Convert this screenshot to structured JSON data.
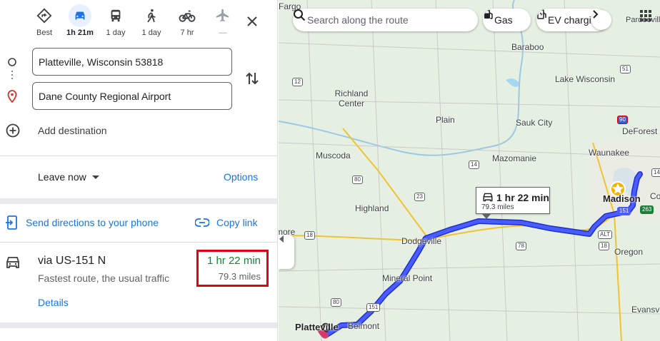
{
  "travel_modes": [
    {
      "name": "best",
      "label": "Best",
      "icon": "diamond-directions-icon"
    },
    {
      "name": "driving",
      "label": "1h 21m",
      "icon": "car-icon",
      "active": true
    },
    {
      "name": "transit",
      "label": "1 day",
      "icon": "bus-icon"
    },
    {
      "name": "walking",
      "label": "1 day",
      "icon": "walk-icon"
    },
    {
      "name": "cycling",
      "label": "7 hr",
      "icon": "bike-icon"
    },
    {
      "name": "flights",
      "label": "—",
      "icon": "plane-icon",
      "disabled": true
    }
  ],
  "origin": {
    "value": "Platteville, Wisconsin 53818"
  },
  "destination": {
    "value": "Dane County Regional Airport"
  },
  "add_destination": "Add destination",
  "depart": {
    "leave_now": "Leave now",
    "options": "Options"
  },
  "share": {
    "send_to_phone": "Send directions to your phone",
    "copy_link": "Copy link"
  },
  "route": {
    "via": "via US-151 N",
    "description": "Fastest route, the usual traffic",
    "details": "Details",
    "time": "1 hr 22 min",
    "distance": "79.3 miles"
  },
  "map": {
    "search_placeholder": "Search along the route",
    "chips": {
      "gas": "Gas",
      "ev": "EV charging"
    },
    "bubble": {
      "time": "1 hr 22 min",
      "distance": "79.3 miles"
    },
    "route_color": "#3b3bf0",
    "towns": {
      "fargo": "Fargo",
      "pardeeville": "Pardeeville",
      "baraboo": "Baraboo",
      "lake_wisconsin": "Lake Wisconsin",
      "richland_center": "Richland Center",
      "plain": "Plain",
      "sauk_city": "Sauk City",
      "deforest": "DeForest",
      "mazomanie": "Mazomanie",
      "muscoda": "Muscoda",
      "waunakee": "Waunakee",
      "madison": "Madison",
      "co": "Co",
      "highland": "Highland",
      "more": "more",
      "dodgeville": "Dodgeville",
      "oregon": "Oregon",
      "mineral_point": "Mineral Point",
      "evansv": "Evansv",
      "platteville": "Platteville",
      "belmont": "Belmont"
    },
    "shields": [
      "12",
      "51",
      "14",
      "90",
      "80",
      "14",
      "23",
      "18",
      "78",
      "18",
      "151",
      "80",
      "ALT",
      "151",
      "263"
    ]
  }
}
